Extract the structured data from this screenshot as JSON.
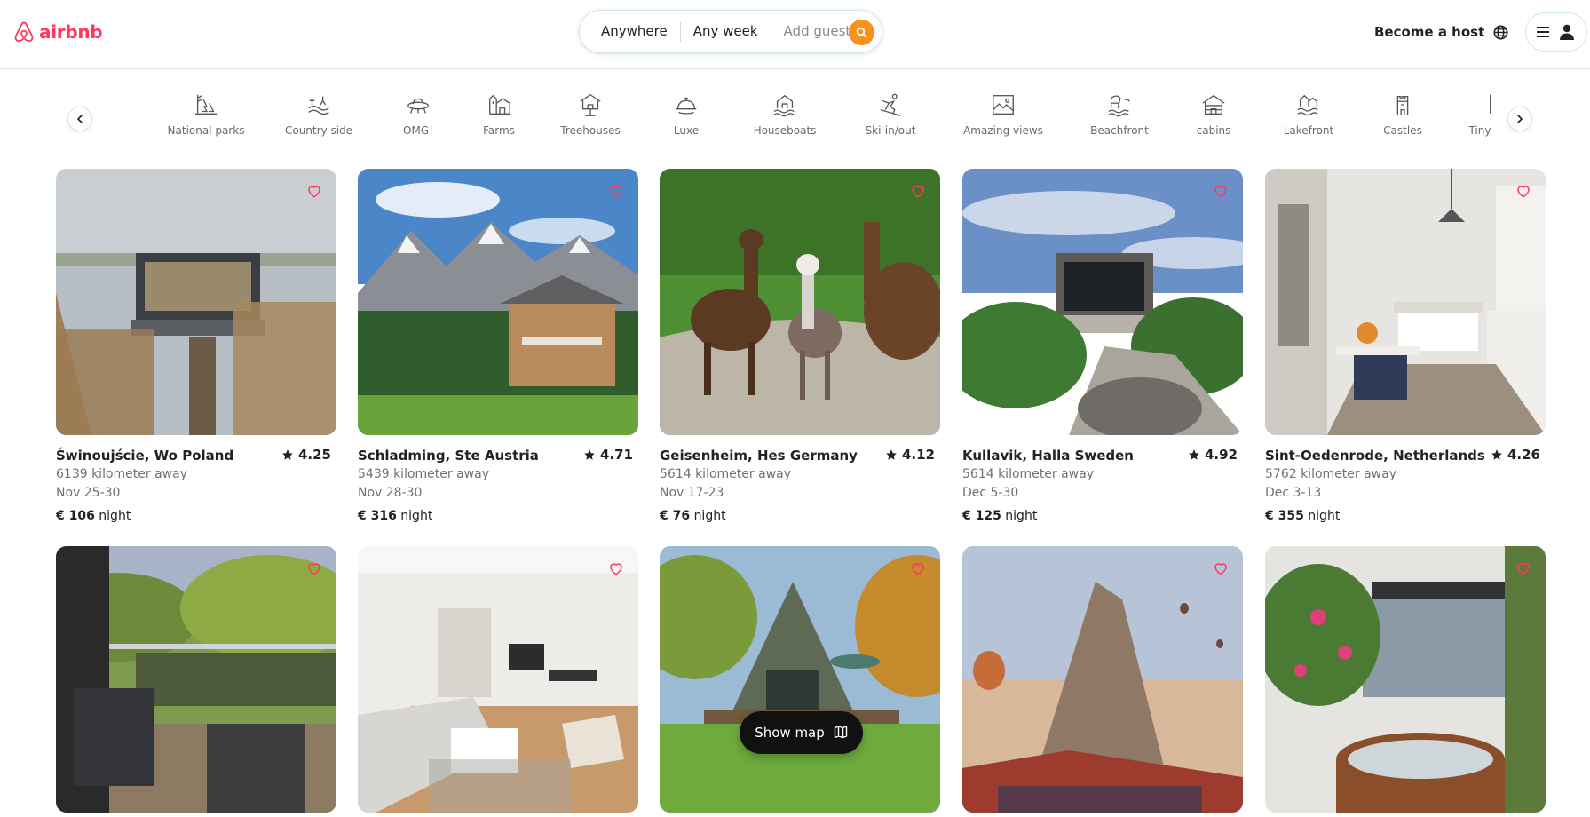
{
  "brand": {
    "name": "airbnb",
    "color": "#ff385c"
  },
  "search": {
    "location": "Anywhere",
    "dates": "Any week",
    "guests_placeholder": "Add guests",
    "button_color": "#f7921e",
    "button_icon": "search-icon"
  },
  "header_right": {
    "host_label": "Become a host",
    "globe_icon": "globe-icon",
    "menu_icon": "hamburger-icon",
    "avatar_icon": "user-icon"
  },
  "categories": [
    {
      "label": "National parks",
      "icon": "national-parks-icon"
    },
    {
      "label": "Country side",
      "icon": "countryside-icon"
    },
    {
      "label": "OMG!",
      "icon": "ufo-icon"
    },
    {
      "label": "Farms",
      "icon": "farm-icon"
    },
    {
      "label": "Treehouses",
      "icon": "treehouse-icon"
    },
    {
      "label": "Luxe",
      "icon": "luxe-bell-icon"
    },
    {
      "label": "Houseboats",
      "icon": "houseboat-icon"
    },
    {
      "label": "Ski-in/out",
      "icon": "skier-icon"
    },
    {
      "label": "Amazing views",
      "icon": "picture-icon"
    },
    {
      "label": "Beachfront",
      "icon": "beach-icon"
    },
    {
      "label": "cabins",
      "icon": "cabin-icon"
    },
    {
      "label": "Lakefront",
      "icon": "lake-icon"
    },
    {
      "label": "Castles",
      "icon": "castle-icon"
    },
    {
      "label": "Tiny homes",
      "icon": "tiny-home-icon"
    }
  ],
  "listings": [
    {
      "title": "Świnoujście, Wo Poland",
      "rating": "4.25",
      "distance": "6139 kilometer away",
      "dates": "Nov 25-30",
      "price": "€ 106",
      "unit": "night"
    },
    {
      "title": "Schladming, Ste Austria",
      "rating": "4.71",
      "distance": "5439 kilometer away",
      "dates": "Nov 28-30",
      "price": "€ 316",
      "unit": "night"
    },
    {
      "title": "Geisenheim, Hes Germany",
      "rating": "4.12",
      "distance": "5614 kilometer away",
      "dates": "Nov 17-23",
      "price": "€ 76",
      "unit": "night"
    },
    {
      "title": "Kullavik, Halla Sweden",
      "rating": "4.92",
      "distance": "5614 kilometer away",
      "dates": "Dec 5-30",
      "price": "€ 125",
      "unit": "night"
    },
    {
      "title": "Sint-Oedenrode, Netherlands",
      "rating": "4.26",
      "distance": "5762 kilometer away",
      "dates": "Dec 3-13",
      "price": "€ 355",
      "unit": "night"
    },
    {
      "title": "",
      "rating": "",
      "distance": "",
      "dates": "",
      "price": "",
      "unit": ""
    },
    {
      "title": "",
      "rating": "",
      "distance": "",
      "dates": "",
      "price": "",
      "unit": ""
    },
    {
      "title": "",
      "rating": "",
      "distance": "",
      "dates": "",
      "price": "",
      "unit": ""
    },
    {
      "title": "",
      "rating": "",
      "distance": "",
      "dates": "",
      "price": "",
      "unit": ""
    },
    {
      "title": "",
      "rating": "",
      "distance": "",
      "dates": "",
      "price": "",
      "unit": ""
    }
  ],
  "show_map": {
    "label": "Show map",
    "icon": "map-icon"
  },
  "colors": {
    "heart": "#ff385c",
    "accent_border": "#cfe7ea"
  }
}
